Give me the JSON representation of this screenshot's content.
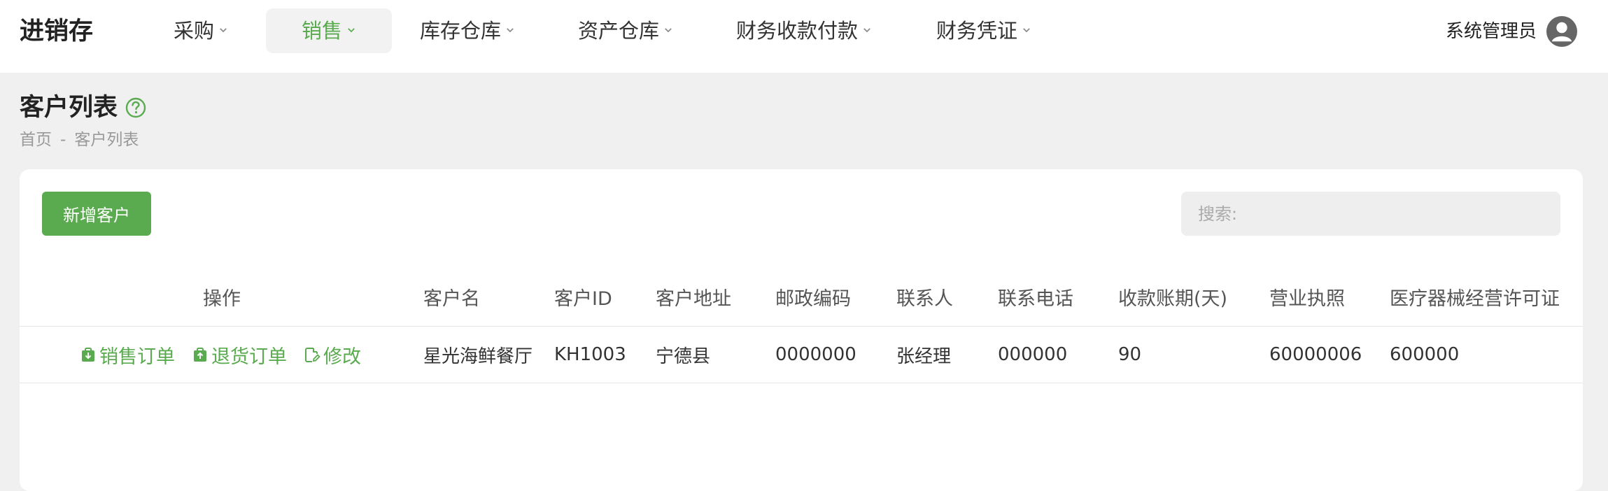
{
  "app": {
    "brand": "进销存"
  },
  "nav": {
    "items": [
      {
        "label": "采购",
        "active": false
      },
      {
        "label": "销售",
        "active": true
      },
      {
        "label": "库存仓库",
        "active": false
      },
      {
        "label": "资产仓库",
        "active": false
      },
      {
        "label": "财务收款付款",
        "active": false
      },
      {
        "label": "财务凭证",
        "active": false
      }
    ]
  },
  "user": {
    "name": "系统管理员",
    "icon": "user-avatar-icon"
  },
  "page": {
    "title": "客户列表",
    "help_icon": "question-circle-icon",
    "breadcrumb": [
      "首页",
      "-",
      "客户列表"
    ]
  },
  "toolbar": {
    "add_label": "新增客户",
    "search_placeholder": "搜索:"
  },
  "table": {
    "headers": [
      "操作",
      "客户名",
      "客户ID",
      "客户地址",
      "邮政编码",
      "联系人",
      "联系电话",
      "收款账期(天)",
      "营业执照",
      "医疗器械经营许可证"
    ],
    "actions": [
      {
        "label": "销售订单",
        "icon": "download-bag-icon"
      },
      {
        "label": "退货订单",
        "icon": "upload-bag-icon"
      },
      {
        "label": "修改",
        "icon": "edit-icon"
      }
    ],
    "rows": [
      [
        "星光海鲜餐厅",
        "KH1003",
        "宁德县",
        "0000000",
        "张经理",
        "000000",
        "90",
        "60000006",
        "600000"
      ]
    ]
  },
  "colors": {
    "accent": "#5aab4f",
    "background": "#f0f0f0",
    "card": "#ffffff"
  }
}
